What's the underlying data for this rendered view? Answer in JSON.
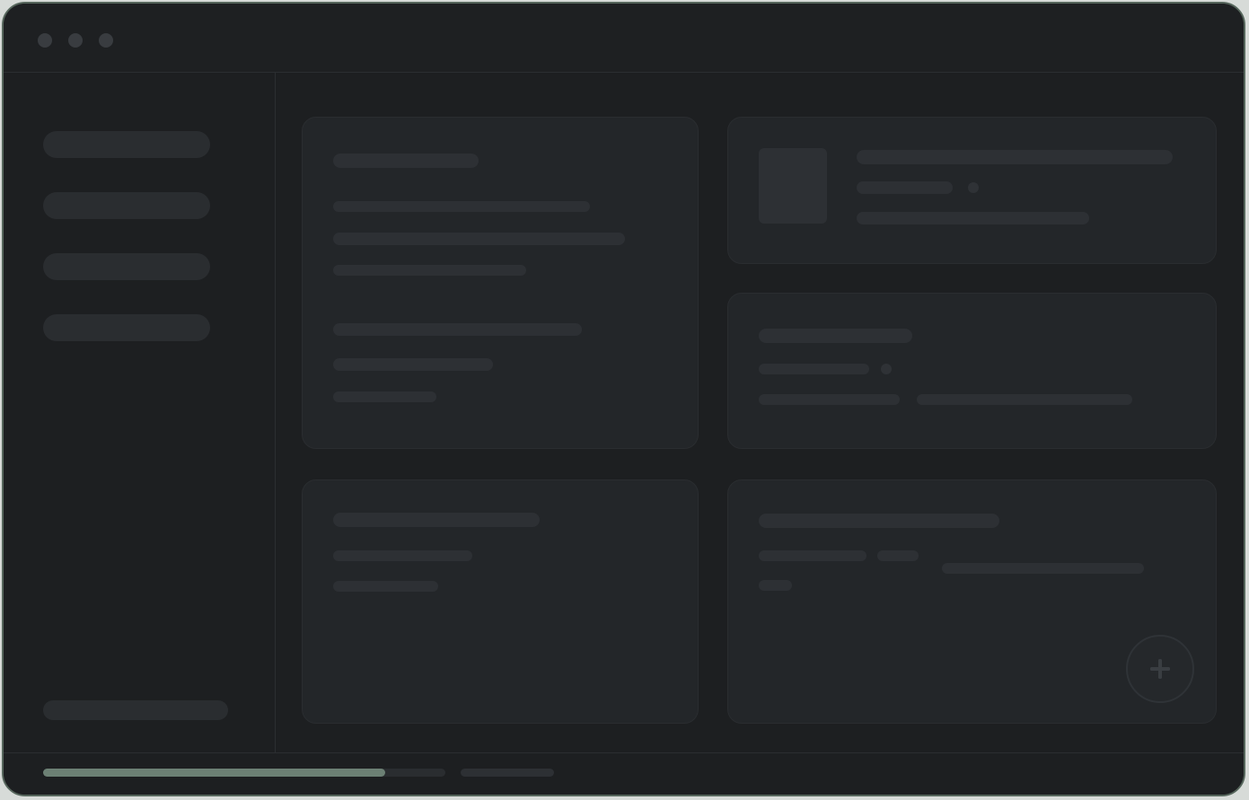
{
  "window": {
    "controls": [
      "close",
      "minimize",
      "maximize"
    ]
  },
  "sidebar": {
    "items": [
      "",
      "",
      "",
      ""
    ],
    "footer": ""
  },
  "cards": [
    {
      "id": "card-top-left"
    },
    {
      "id": "card-top-right"
    },
    {
      "id": "card-middle-right"
    },
    {
      "id": "card-bottom-left"
    },
    {
      "id": "card-bottom-right"
    }
  ],
  "fab": {
    "icon": "plus-icon"
  },
  "status": {
    "progress": 0.85
  },
  "colors": {
    "background": "#1d1f21",
    "card": "#232629",
    "placeholder": "#2d3034",
    "accent": "#6c8074",
    "frame": "#56665c"
  }
}
